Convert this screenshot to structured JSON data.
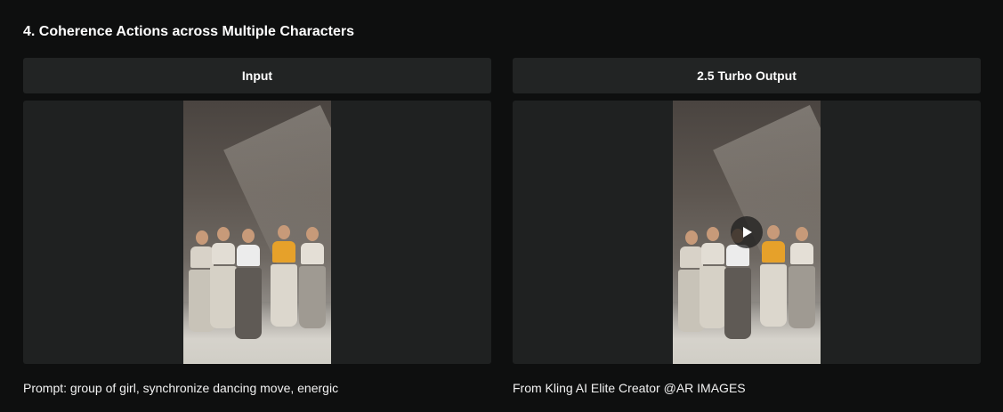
{
  "section": {
    "title": "4. Coherence Actions across Multiple Characters"
  },
  "columns": [
    {
      "header": "Input",
      "caption": "Prompt: group of girl, synchronize dancing move, energic",
      "media": {
        "kind": "image"
      }
    },
    {
      "header": "2.5 Turbo Output",
      "caption": "From Kling AI Elite Creator @AR IMAGES",
      "media": {
        "kind": "video",
        "icon": "play-icon"
      }
    }
  ],
  "colors": {
    "background": "#0e0f0f",
    "panel": "#222424",
    "media_panel": "#1f2121",
    "text": "#ffffff"
  }
}
